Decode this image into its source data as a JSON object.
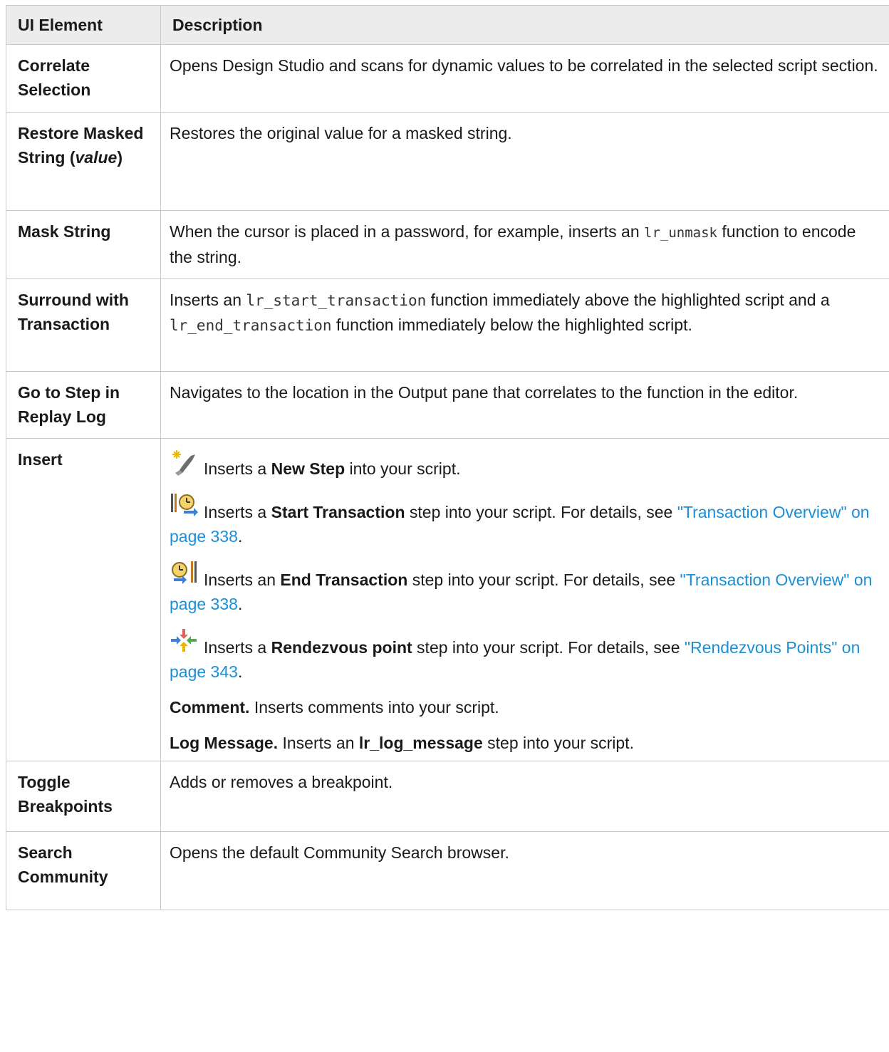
{
  "header": {
    "col1": "UI Element",
    "col2": "Description"
  },
  "rows": {
    "correlate": {
      "name": "Correlate Selection",
      "desc": "Opens Design Studio and scans for dynamic values to be correlated in the selected script section."
    },
    "restore": {
      "name_a": "Restore Masked String (",
      "name_b": "value",
      "name_c": ")",
      "desc": "Restores the original value for a masked string."
    },
    "mask": {
      "name": "Mask String",
      "desc_a": "When the cursor is placed in a password, for example, inserts an ",
      "desc_code": "lr_unmask",
      "desc_b": " function to encode the string."
    },
    "surround": {
      "name": "Surround with Transaction",
      "desc_a": "Inserts an ",
      "code1": "lr_start_transaction",
      "desc_b": " function immediately above the highlighted script and a ",
      "code2": "lr_end_transaction",
      "desc_c": " function immediately below the highlighted script."
    },
    "goto": {
      "name": "Go to Step in Replay Log",
      "desc": "Navigates to the location in the Output pane that correlates to the function in the editor."
    },
    "insert": {
      "name": "Insert",
      "new_step": {
        "a": "Inserts a ",
        "b": "New Step",
        "c": " into your script."
      },
      "start_tx": {
        "a": "Inserts a ",
        "b": "Start Transaction",
        "c": " step into your script. For details, see ",
        "link": "\"Transaction Overview\" on page 338",
        "d": "."
      },
      "end_tx": {
        "a": "Inserts an ",
        "b": "End Transaction",
        "c": " step into your script. For details, see ",
        "link": "\"Transaction Overview\" on page 338",
        "d": "."
      },
      "rendezvous": {
        "a": "Inserts a ",
        "b": "Rendezvous point",
        "c": " step into your script. For details, see ",
        "link": "\"Rendezvous Points\" on page 343",
        "d": "."
      },
      "comment": {
        "b": "Comment.",
        "c": " Inserts comments into your script."
      },
      "log": {
        "b": "Log Message.",
        "c": " Inserts an ",
        "d": "lr_log_message",
        "e": " step into your script."
      }
    },
    "toggle": {
      "name": "Toggle Breakpoints",
      "desc": "Adds or removes a breakpoint."
    },
    "search": {
      "name": "Search Community",
      "desc": "Opens the default Community Search browser."
    }
  }
}
